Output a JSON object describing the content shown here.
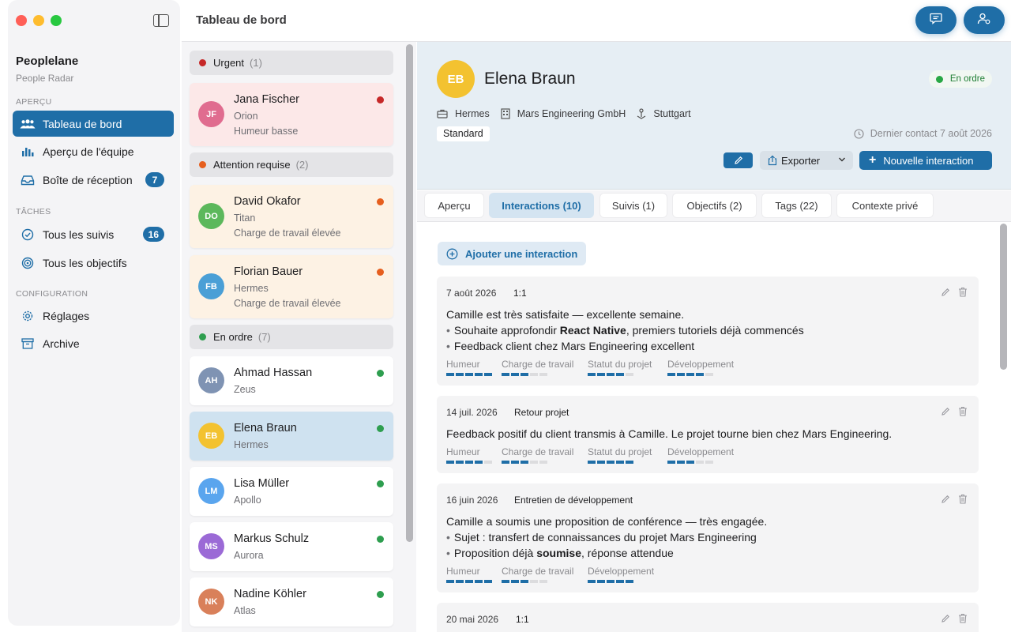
{
  "sidebar": {
    "app_name": "Peoplelane",
    "app_sub": "People Radar",
    "sections": {
      "overview": "APERÇU",
      "tasks": "TÂCHES",
      "config": "CONFIGURATION"
    },
    "items": [
      {
        "label": "Tableau de bord",
        "icon": "people-icon",
        "active": true
      },
      {
        "label": "Aperçu de l'équipe",
        "icon": "bar-chart-icon"
      },
      {
        "label": "Boîte de réception",
        "icon": "inbox-icon",
        "badge": "7"
      },
      {
        "label": "Tous les suivis",
        "icon": "check-circle-icon",
        "badge": "16"
      },
      {
        "label": "Tous les objectifs",
        "icon": "target-icon"
      },
      {
        "label": "Réglages",
        "icon": "gear-icon"
      },
      {
        "label": "Archive",
        "icon": "archive-icon"
      }
    ]
  },
  "header": {
    "title": "Tableau de bord"
  },
  "list": {
    "groups": [
      {
        "label": "Urgent",
        "count": "(1)",
        "color": "#c62828"
      },
      {
        "label": "Attention requise",
        "count": "(2)",
        "color": "#e65f1e"
      },
      {
        "label": "En ordre",
        "count": "(7)",
        "color": "#2e9e4f"
      }
    ],
    "people": [
      {
        "initials": "JF",
        "name": "Jana Fischer",
        "project": "Orion",
        "note": "Humeur basse",
        "avatar_color": "#e06c8f",
        "dot": "#c62828"
      },
      {
        "initials": "DO",
        "name": "David Okafor",
        "project": "Titan",
        "note": "Charge de travail élevée",
        "avatar_color": "#5cb85c",
        "dot": "#e65f1e"
      },
      {
        "initials": "FB",
        "name": "Florian Bauer",
        "project": "Hermes",
        "note": "Charge de travail élevée",
        "avatar_color": "#4a9fd6",
        "dot": "#e65f1e"
      },
      {
        "initials": "AH",
        "name": "Ahmad Hassan",
        "project": "Zeus",
        "avatar_color": "#7f93b3",
        "dot": "#2e9e4f"
      },
      {
        "initials": "EB",
        "name": "Elena Braun",
        "project": "Hermes",
        "avatar_color": "#f3c230",
        "dot": "#2e9e4f"
      },
      {
        "initials": "LM",
        "name": "Lisa Müller",
        "project": "Apollo",
        "avatar_color": "#5aa5ee",
        "dot": "#2e9e4f"
      },
      {
        "initials": "MS",
        "name": "Markus Schulz",
        "project": "Aurora",
        "avatar_color": "#9b6ad6",
        "dot": "#2e9e4f"
      },
      {
        "initials": "NK",
        "name": "Nadine Köhler",
        "project": "Atlas",
        "avatar_color": "#d9805a",
        "dot": "#2e9e4f"
      }
    ]
  },
  "detail": {
    "initials": "EB",
    "name": "Elena Braun",
    "status": "En ordre",
    "project": "Hermes",
    "company": "Mars Engineering GmbH",
    "location": "Stuttgart",
    "tier": "Standard",
    "last_contact": "Dernier contact 7 août 2026",
    "export_label": "Exporter",
    "new_label": "Nouvelle interaction",
    "tabs": [
      {
        "label": "Aperçu"
      },
      {
        "label": "Interactions (10)",
        "active": true
      },
      {
        "label": "Suivis (1)"
      },
      {
        "label": "Objectifs (2)"
      },
      {
        "label": "Tags (22)"
      },
      {
        "label": "Contexte privé"
      }
    ],
    "add_interaction": "Ajouter une interaction",
    "interactions": [
      {
        "date": "7 août 2026",
        "type": "1:1",
        "line1": "Camille est très satisfaite — excellente semaine.",
        "bullets": [
          {
            "pre": "Souhaite approfondir ",
            "bold": "React Native",
            "post": ", premiers tutoriels déjà commencés"
          },
          {
            "pre": "Feedback client chez Mars Engineering excellent",
            "bold": "",
            "post": ""
          }
        ],
        "metrics": [
          {
            "label": "Humeur",
            "level": 5
          },
          {
            "label": "Charge de travail",
            "level": 3
          },
          {
            "label": "Statut du projet",
            "level": 4
          },
          {
            "label": "Développement",
            "level": 4
          }
        ]
      },
      {
        "date": "14 juil. 2026",
        "type": "Retour projet",
        "line1": "Feedback positif du client transmis à Camille. Le projet tourne bien chez Mars Engineering.",
        "metrics": [
          {
            "label": "Humeur",
            "level": 4
          },
          {
            "label": "Charge de travail",
            "level": 3
          },
          {
            "label": "Statut du projet",
            "level": 5
          },
          {
            "label": "Développement",
            "level": 3
          }
        ]
      },
      {
        "date": "16 juin 2026",
        "type": "Entretien de développement",
        "line1": "Camille a soumis une proposition de conférence — très engagée.",
        "bullets": [
          {
            "pre": "Sujet : transfert de connaissances du projet Mars Engineering",
            "bold": "",
            "post": ""
          },
          {
            "pre": "Proposition déjà ",
            "bold": "soumise",
            "post": ", réponse attendue"
          }
        ],
        "metrics": [
          {
            "label": "Humeur",
            "level": 5
          },
          {
            "label": "Charge de travail",
            "level": 3
          },
          {
            "label": "Développement",
            "level": 5
          }
        ]
      },
      {
        "date": "20 mai 2026",
        "type": "1:1"
      }
    ]
  }
}
